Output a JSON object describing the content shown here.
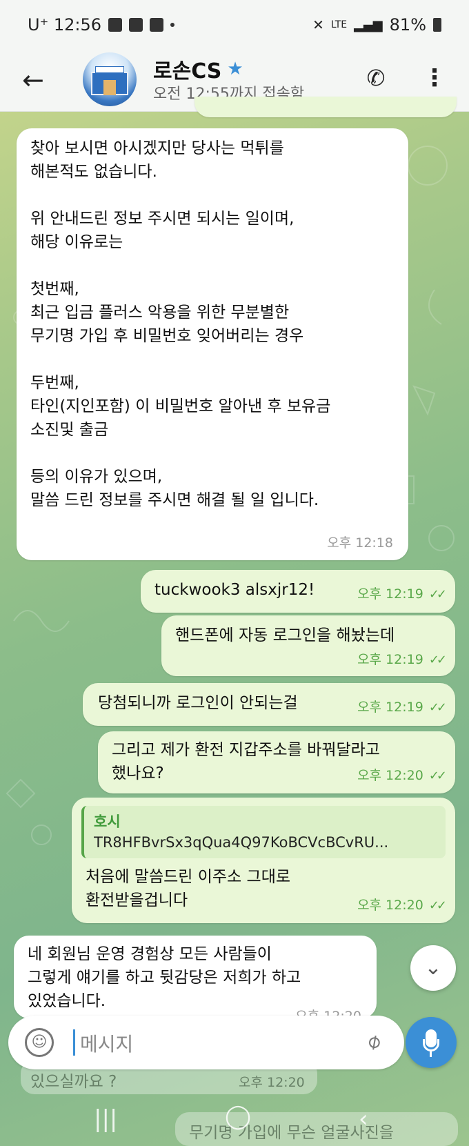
{
  "status_bar": {
    "carrier_time": "U⁺ 12:56",
    "battery": "81%",
    "network": "LTE"
  },
  "header": {
    "title": "로손CS",
    "subtitle": "오전 12:55까지 접속함"
  },
  "messages": [
    {
      "direction": "in",
      "text": "찾아 보시면 아시겠지만 당사는 먹튀를\n해본적도 없습니다.\n\n위 안내드린 정보 주시면 되시는 일이며,\n해당 이유로는\n\n첫번째,\n최근 입금 플러스 악용을 위한 무분별한\n무기명 가입 후 비밀번호 잊어버리는 경우\n\n두번째,\n타인(지인포함) 이 비밀번호 알아낸 후 보유금\n소진및 출금\n\n등의 이유가 있으며,\n말씀 드린 정보를 주시면 해결 될 일 입니다.",
      "time": "오후 12:18"
    },
    {
      "direction": "out",
      "text": "tuckwook3 alsxjr12!",
      "time": "오후 12:19"
    },
    {
      "direction": "out",
      "text": "핸드폰에 자동 로그인을 해놨는데",
      "time": "오후 12:19"
    },
    {
      "direction": "out",
      "text": "당첨되니까 로그인이 안되는걸",
      "time": "오후 12:19"
    },
    {
      "direction": "out",
      "text": "그리고 제가 환전 지갑주소를 바꿔달라고\n했나요?",
      "time": "오후 12:20"
    },
    {
      "direction": "out",
      "reply_name": "호시",
      "reply_text": "TR8HFBvrSx3qQua4Q97KoBCVcBCvRU...",
      "text": "처음에 말씀드린 이주소 그대로\n환전받을겁니다",
      "time": "오후 12:20"
    },
    {
      "direction": "in",
      "text": "네 회원님 운영 경험상 모든 사람들이\n그렇게 얘기를 하고 뒷감당은 저희가 하고\n있었습니다.",
      "time": "오후 12:20"
    }
  ],
  "background_ghost": {
    "line1": "있으실까요 ?",
    "time": "오후 12:20",
    "line2": "무기명 가입에 무슨 얼굴사진을"
  },
  "composer": {
    "placeholder": "메시지"
  },
  "icons": {
    "back": "back-arrow-icon",
    "call": "phone-icon",
    "more": "more-vertical-icon",
    "verified": "star-icon",
    "emoji": "emoji-icon",
    "attach": "paperclip-icon",
    "mic": "microphone-icon",
    "scroll": "chevron-down-icon"
  },
  "colors": {
    "accent": "#3b8fd6",
    "outgoing_bubble": "#eaf7d7",
    "read_checks": "#5aa84a"
  }
}
